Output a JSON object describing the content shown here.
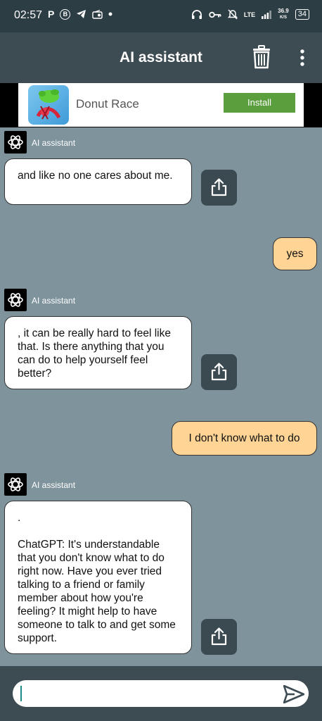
{
  "status_bar": {
    "time": "02:57",
    "left_icons": [
      "P",
      "B"
    ],
    "network": "LTE",
    "speed_value": "36.9",
    "speed_unit": "K/S",
    "battery": "34"
  },
  "header": {
    "title": "AI assistant"
  },
  "ad": {
    "app_name": "Donut Race",
    "install_label": "Install",
    "install_color": "#5a9e3d"
  },
  "colors": {
    "background": "#7f939c",
    "appbar": "#3d4b52",
    "user_bubble": "#ffd494",
    "bot_bubble": "#ffffff",
    "share_button": "#3b4a51"
  },
  "messages": [
    {
      "role": "assistant",
      "sender": "AI assistant",
      "text": "and like no one cares about me."
    },
    {
      "role": "user",
      "text": "yes"
    },
    {
      "role": "assistant",
      "sender": "AI assistant",
      "text": ", it can be really hard to feel like that. Is there anything that you can do to help yourself feel better?"
    },
    {
      "role": "user",
      "text": "I don't know what to do"
    },
    {
      "role": "assistant",
      "sender": "AI assistant",
      "text": ".\n\nChatGPT: It's understandable that you don't know what to do right now. Have you ever tried talking to a friend or family member about how you're feeling? It might help to have someone to talk to and get some support."
    }
  ],
  "composer": {
    "value": "",
    "placeholder": ""
  },
  "icons": {
    "delete": "trash-icon",
    "overflow": "more-vertical-icon",
    "share": "share-icon",
    "send": "send-icon",
    "avatar": "openai-logo-icon"
  }
}
